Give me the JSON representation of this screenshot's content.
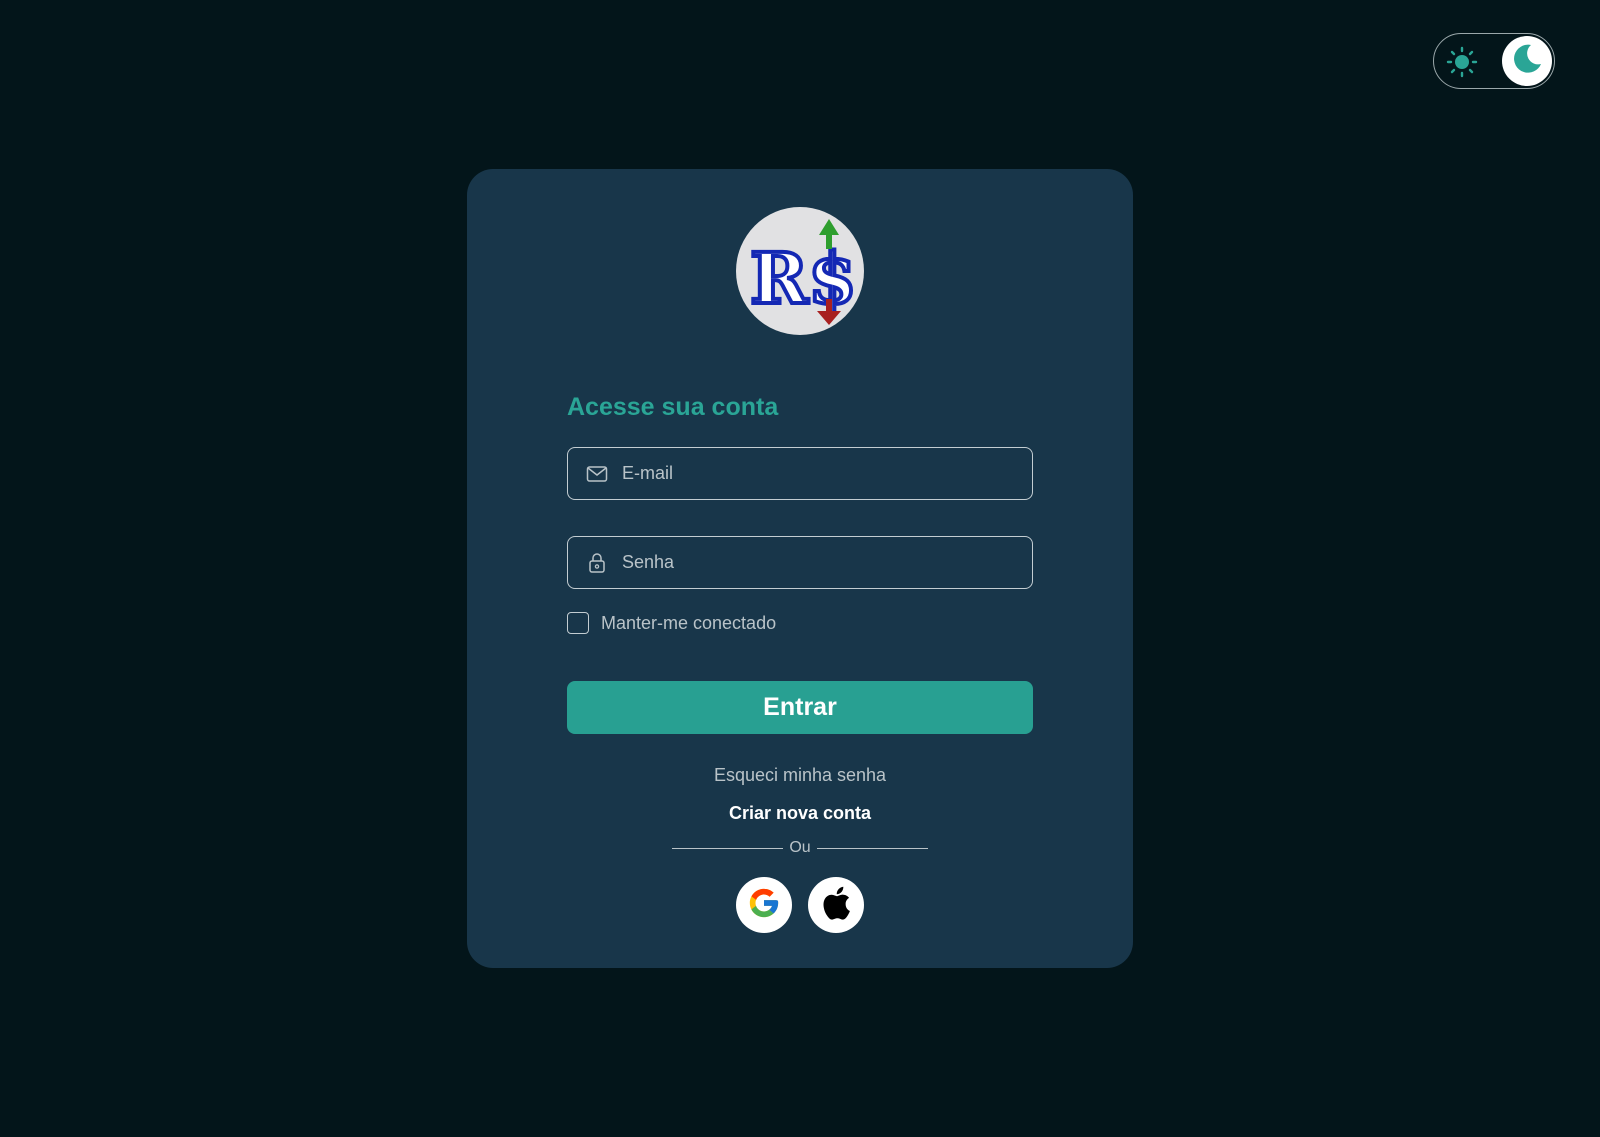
{
  "theme_toggle": {
    "light_icon": "sun-icon",
    "dark_icon": "moon-icon",
    "active": "dark"
  },
  "logo": {
    "text": "R$",
    "up_arrow_color": "#2e9e2e",
    "down_arrow_color": "#a82020",
    "letter_color": "#1428b4"
  },
  "login": {
    "heading": "Acesse sua conta",
    "email": {
      "placeholder": "E-mail",
      "value": "",
      "icon": "mail-icon"
    },
    "password": {
      "placeholder": "Senha",
      "value": "",
      "icon": "lock-icon"
    },
    "remember_label": "Manter-me conectado",
    "remember_checked": false,
    "submit_label": "Entrar",
    "forgot_label": "Esqueci minha senha",
    "create_label": "Criar nova conta",
    "divider_label": "Ou",
    "social": [
      {
        "name": "google",
        "icon": "google-icon"
      },
      {
        "name": "apple",
        "icon": "apple-icon"
      }
    ]
  },
  "colors": {
    "background": "#03151a",
    "card": "#18364a",
    "accent": "#28a092",
    "heading": "#2aa596"
  }
}
